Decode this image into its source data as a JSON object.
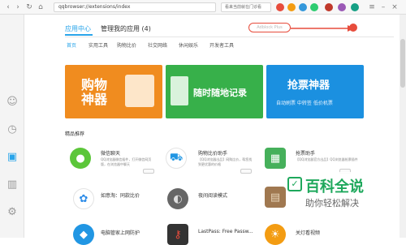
{
  "browser": {
    "url": "qqbrowser://extensions/index",
    "search_text": "看来当前就在门诊看",
    "colors": {
      "toolbar": "#f7f7f7",
      "accent": "#2aa5ea"
    }
  },
  "tabs": {
    "app_center": "应用中心",
    "my_apps": "管理我的应用 (4)"
  },
  "subtabs": [
    "首页",
    "实用工具",
    "购物比价",
    "社交网络",
    "休闲娱乐",
    "开发者工具"
  ],
  "banners": [
    {
      "text": "购物神器",
      "color": "#f08c1f"
    },
    {
      "text": "随时随地记录",
      "color": "#37b04a"
    },
    {
      "text": "抢票神器",
      "sub": "自动刷票 中转签 低价机票",
      "color": "#1b90e0"
    }
  ],
  "callout": {
    "button_label": "Adblock Plus"
  },
  "section": {
    "title": "精品推荐"
  },
  "apps": [
    {
      "name": "微信聊天",
      "desc": "QQ浏览器微信插件，打开微信网页版，在浏览器中聊天",
      "icon": "wechat-icon",
      "color": "#5cc63a"
    },
    {
      "name": "购物比价助手",
      "desc": "【QQ浏览器出品】网购比价，帮您找到更优惠的价格",
      "icon": "cart-icon",
      "color": "#2196e3"
    },
    {
      "name": "抢票助手",
      "desc": "【QQ浏览器官方出品】QQ浏览器抢票插件",
      "icon": "train-icon",
      "color": "#46b05b"
    },
    {
      "name": "如意淘：同款比价",
      "desc": "",
      "icon": "shopping-icon",
      "color": "#2d8ce8"
    },
    {
      "name": "夜间阅读模式",
      "desc": "",
      "icon": "moon-icon",
      "color": "#888888"
    },
    {
      "name": "",
      "desc": "",
      "icon": "radio-icon",
      "color": "#a07850"
    },
    {
      "name": "电脑管家上网防护",
      "desc": "",
      "icon": "shield-icon",
      "color": "#2196e3"
    },
    {
      "name": "LastPass: Free Passw...",
      "desc": "",
      "icon": "key-icon",
      "color": "#333333"
    },
    {
      "name": "关灯看视频",
      "desc": "",
      "icon": "lamp-icon",
      "color": "#f39c12"
    }
  ],
  "watermark": {
    "title": "百科全说",
    "subtitle": "助你轻松解决"
  }
}
